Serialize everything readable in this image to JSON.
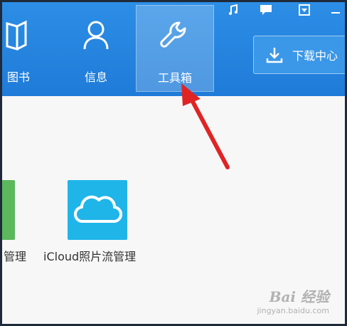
{
  "nav": {
    "items": [
      {
        "label": "图书",
        "icon": "book-icon"
      },
      {
        "label": "信息",
        "icon": "person-icon"
      },
      {
        "label": "工具箱",
        "icon": "wrench-icon",
        "active": true
      }
    ]
  },
  "window_controls": [
    "music-icon",
    "message-icon",
    "dropdown-icon",
    "minimize-icon"
  ],
  "download_button": {
    "label": "下载中心",
    "icon": "download-icon"
  },
  "apps": [
    {
      "label": "管理",
      "color": "#5cb85c"
    },
    {
      "label": "iCloud照片流管理",
      "color": "#1fb5e9",
      "icon": "cloud-icon"
    }
  ],
  "watermark": {
    "main": "Bai 经验",
    "sub": "jingyan.baidu.com"
  },
  "colors": {
    "topbar": "#2284de",
    "arrow": "#e02424",
    "outer_border": "#1e2a3a"
  }
}
